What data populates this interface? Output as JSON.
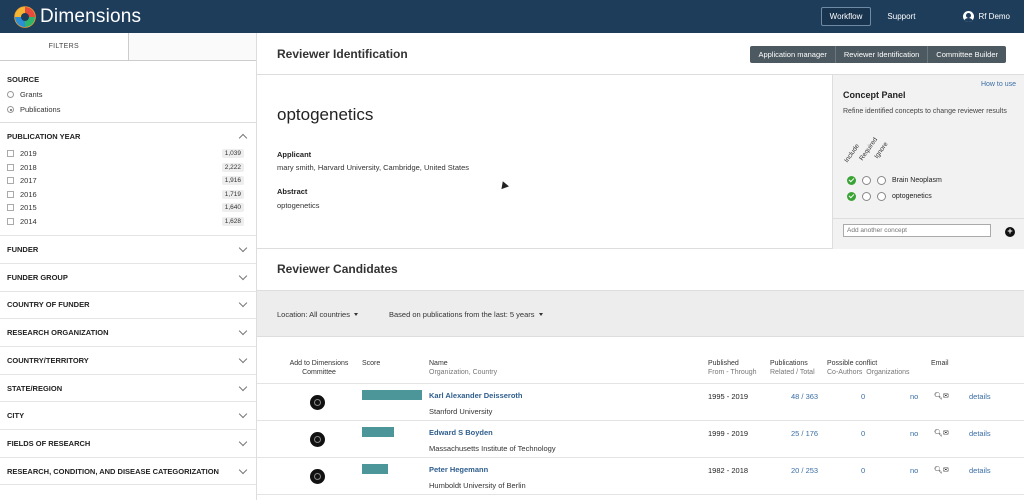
{
  "app": {
    "brand": "Dimensions",
    "nav_workflow": "Workflow",
    "nav_support": "Support",
    "user_name": "Rf Demo"
  },
  "sidebar": {
    "tabs": [
      "FILTERS",
      ""
    ],
    "source_heading": "SOURCE",
    "source_options": [
      {
        "label": "Grants",
        "selected": false
      },
      {
        "label": "Publications",
        "selected": true
      }
    ],
    "pub_year_heading": "PUBLICATION YEAR",
    "years": [
      {
        "year": "2019",
        "count": "1,039"
      },
      {
        "year": "2018",
        "count": "2,222"
      },
      {
        "year": "2017",
        "count": "1,916"
      },
      {
        "year": "2016",
        "count": "1,719"
      },
      {
        "year": "2015",
        "count": "1,640"
      },
      {
        "year": "2014",
        "count": "1,628"
      }
    ],
    "facets": [
      "FUNDER",
      "FUNDER GROUP",
      "COUNTRY OF FUNDER",
      "RESEARCH ORGANIZATION",
      "COUNTRY/TERRITORY",
      "STATE/REGION",
      "CITY",
      "FIELDS OF RESEARCH",
      "RESEARCH, CONDITION, AND DISEASE CATEGORIZATION"
    ]
  },
  "main": {
    "title": "Reviewer Identification",
    "buttons": [
      "Application manager",
      "Reviewer Identification",
      "Committee Builder"
    ],
    "query": "optogenetics",
    "applicant_label": "Applicant",
    "applicant_value": "mary smith, Harvard University, Cambridge, United States",
    "abstract_label": "Abstract",
    "abstract_value": "optogenetics"
  },
  "concept_panel": {
    "how_to": "How to use",
    "title": "Concept Panel",
    "description": "Refine identified concepts to change reviewer results",
    "col_include": "Include",
    "col_required": "Required",
    "col_ignore": "Ignore",
    "concepts": [
      "Brain Neoplasm",
      "optogenetics"
    ],
    "input_placeholder": "Add another concept"
  },
  "candidates": {
    "title": "Reviewer Candidates",
    "location_filter": "Location: All countries",
    "time_filter": "Based on publications from the last: 5 years",
    "headers": {
      "add": "Add to Dimensions",
      "add_sub": "Committee",
      "score": "Score",
      "name": "Name",
      "name_sub": "Organization, Country",
      "published": "Published",
      "published_sub": "From - Through",
      "pubs": "Publications",
      "pubs_sub": "Related / Total",
      "conflict": "Possible conflict",
      "conflict_sub_a": "Co-Authors",
      "conflict_sub_b": "Organizations",
      "email": "Email"
    },
    "rows": [
      {
        "name": "Karl Alexander Deisseroth",
        "org": "Stanford University",
        "years": "1995 - 2019",
        "pubs": "48 / 363",
        "coauthors": "0",
        "orgs": "no",
        "details": "details",
        "score": 0.94
      },
      {
        "name": "Edward S Boyden",
        "org": "Massachusetts Institute of Technology",
        "years": "1999 - 2019",
        "pubs": "25 / 176",
        "coauthors": "0",
        "orgs": "no",
        "details": "details",
        "score": 0.5
      },
      {
        "name": "Peter Hegemann",
        "org": "Humboldt University of Berlin",
        "years": "1982 - 2018",
        "pubs": "20 / 253",
        "coauthors": "0",
        "orgs": "no",
        "details": "details",
        "score": 0.4
      }
    ]
  },
  "colors": {
    "topbar": "#1e3d5b",
    "score_bar": "#4c9599",
    "link": "#3a6ea5",
    "green": "#3aa335"
  }
}
